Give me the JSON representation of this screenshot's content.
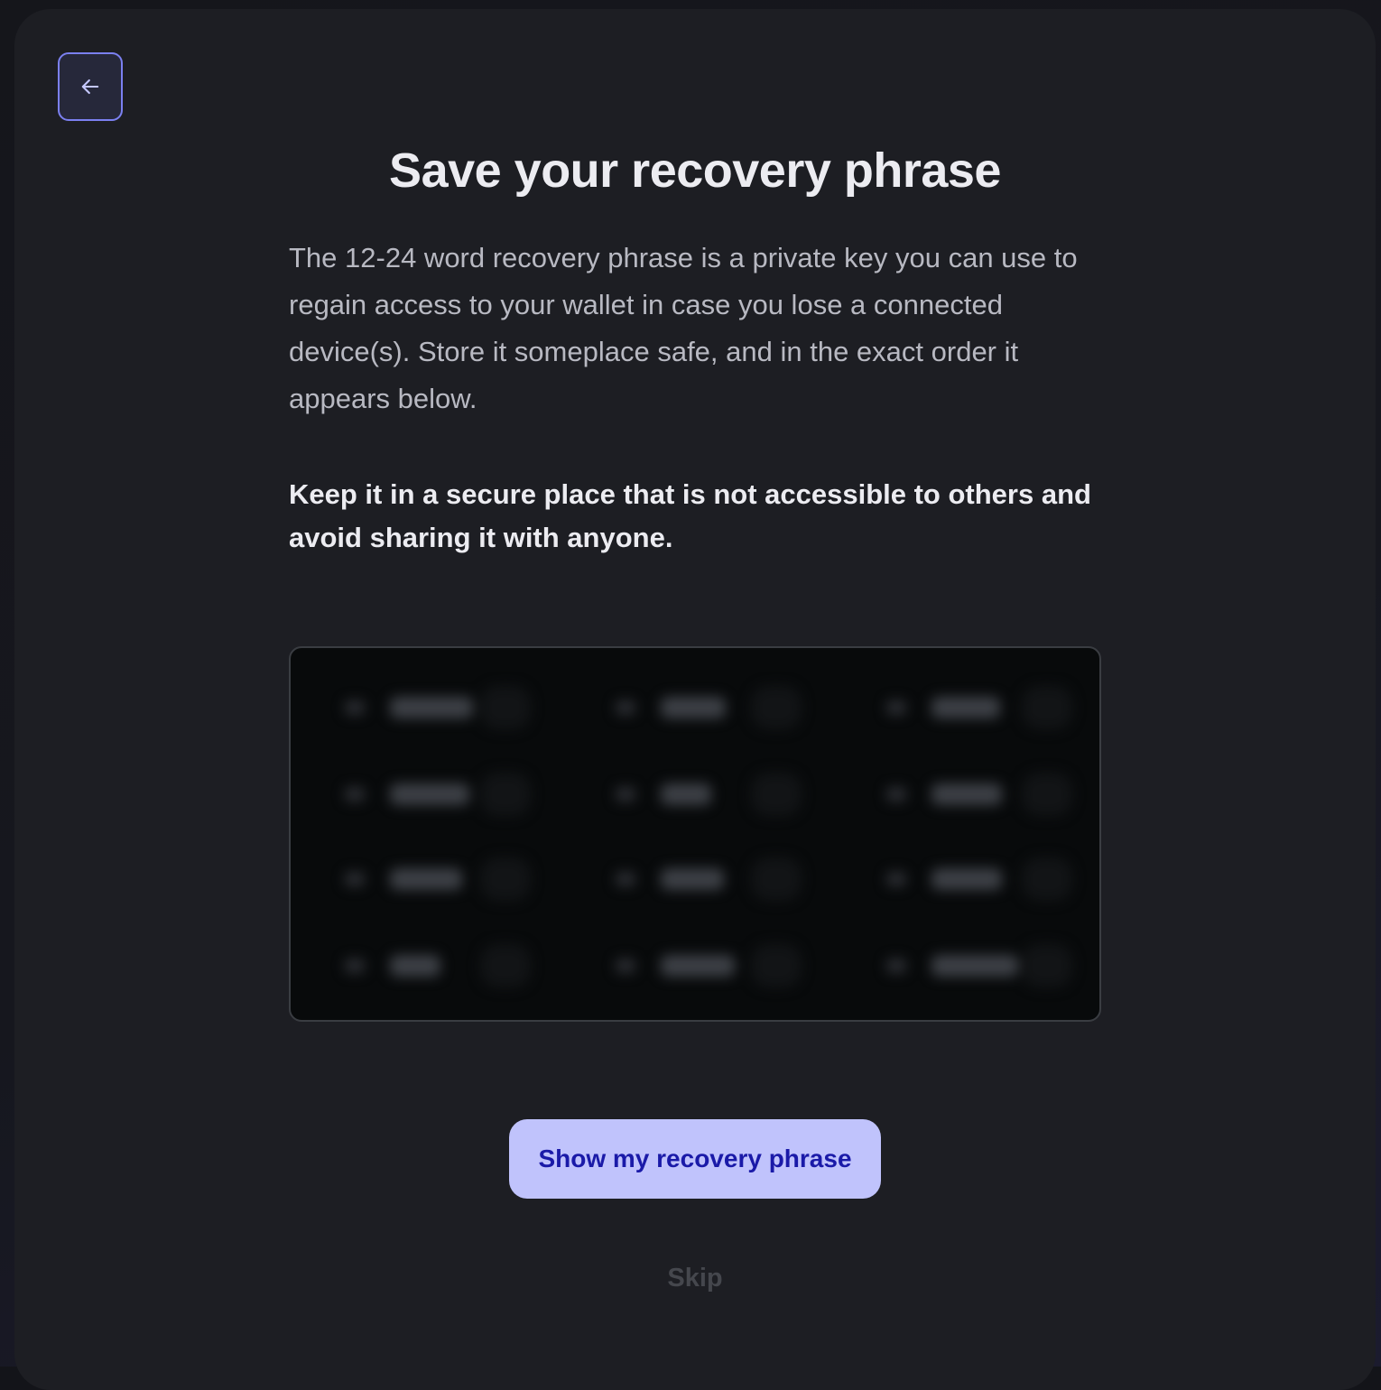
{
  "screen": {
    "title": "Save your recovery phrase",
    "intro": "The 12-24 word recovery phrase is a private key you can use to regain access to your wallet in case you lose a connected device(s). Store it someplace safe, and in the exact order it appears below.",
    "warning": "Keep it in a secure place that is not accessible to others and avoid sharing it with anyone."
  },
  "back_button": {
    "icon": "arrow-left-icon"
  },
  "phrase_box": {
    "state": "blurred",
    "word_count": 12
  },
  "actions": {
    "show_label": "Show my recovery phrase",
    "skip_label": "Skip"
  },
  "colors": {
    "background": "#131419",
    "card": "#1d1e23",
    "accent": "#7b80f0",
    "primary_button": "#c0c3fc",
    "primary_button_text": "#1a1aa8"
  }
}
